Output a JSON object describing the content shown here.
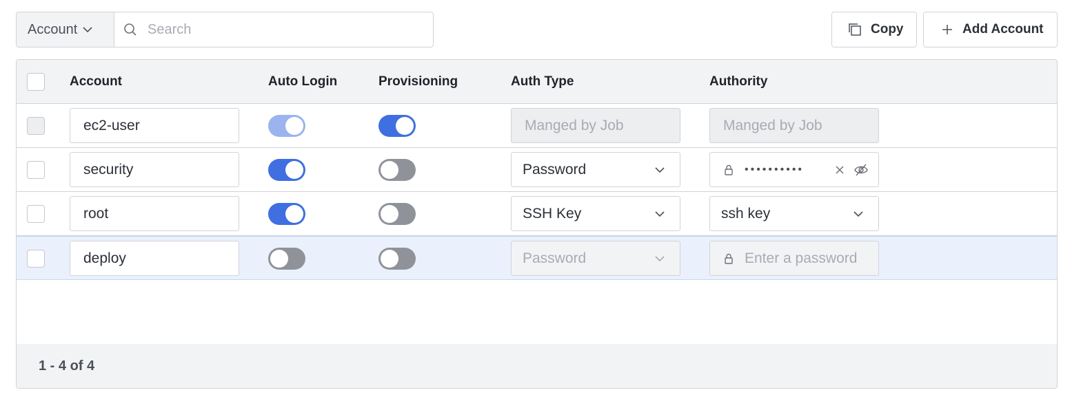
{
  "toolbar": {
    "filter_label": "Account",
    "search_placeholder": "Search",
    "copy_label": "Copy",
    "add_label": "Add Account"
  },
  "table": {
    "columns": [
      "Account",
      "Auto Login",
      "Provisioning",
      "Auth Type",
      "Authority"
    ],
    "rows": [
      {
        "account": "ec2-user",
        "auto_login": "on-disabled",
        "provisioning": "on",
        "auth_type": "Manged by Job",
        "authority": "Manged by Job"
      },
      {
        "account": "security",
        "auto_login": "on",
        "provisioning": "off",
        "auth_type": "Password",
        "authority": "••••••••••"
      },
      {
        "account": "root",
        "auto_login": "on",
        "provisioning": "off",
        "auth_type": "SSH Key",
        "authority": "ssh key"
      },
      {
        "account": "deploy",
        "auto_login": "off",
        "provisioning": "off",
        "auth_type": "Password",
        "authority_placeholder": "Enter a password"
      }
    ]
  },
  "pagination": {
    "summary": "1 - 4 of 4"
  },
  "colors": {
    "accent": "#3f6fe0",
    "selected_row": "#eaf1fc",
    "header_bg": "#f2f3f5"
  }
}
